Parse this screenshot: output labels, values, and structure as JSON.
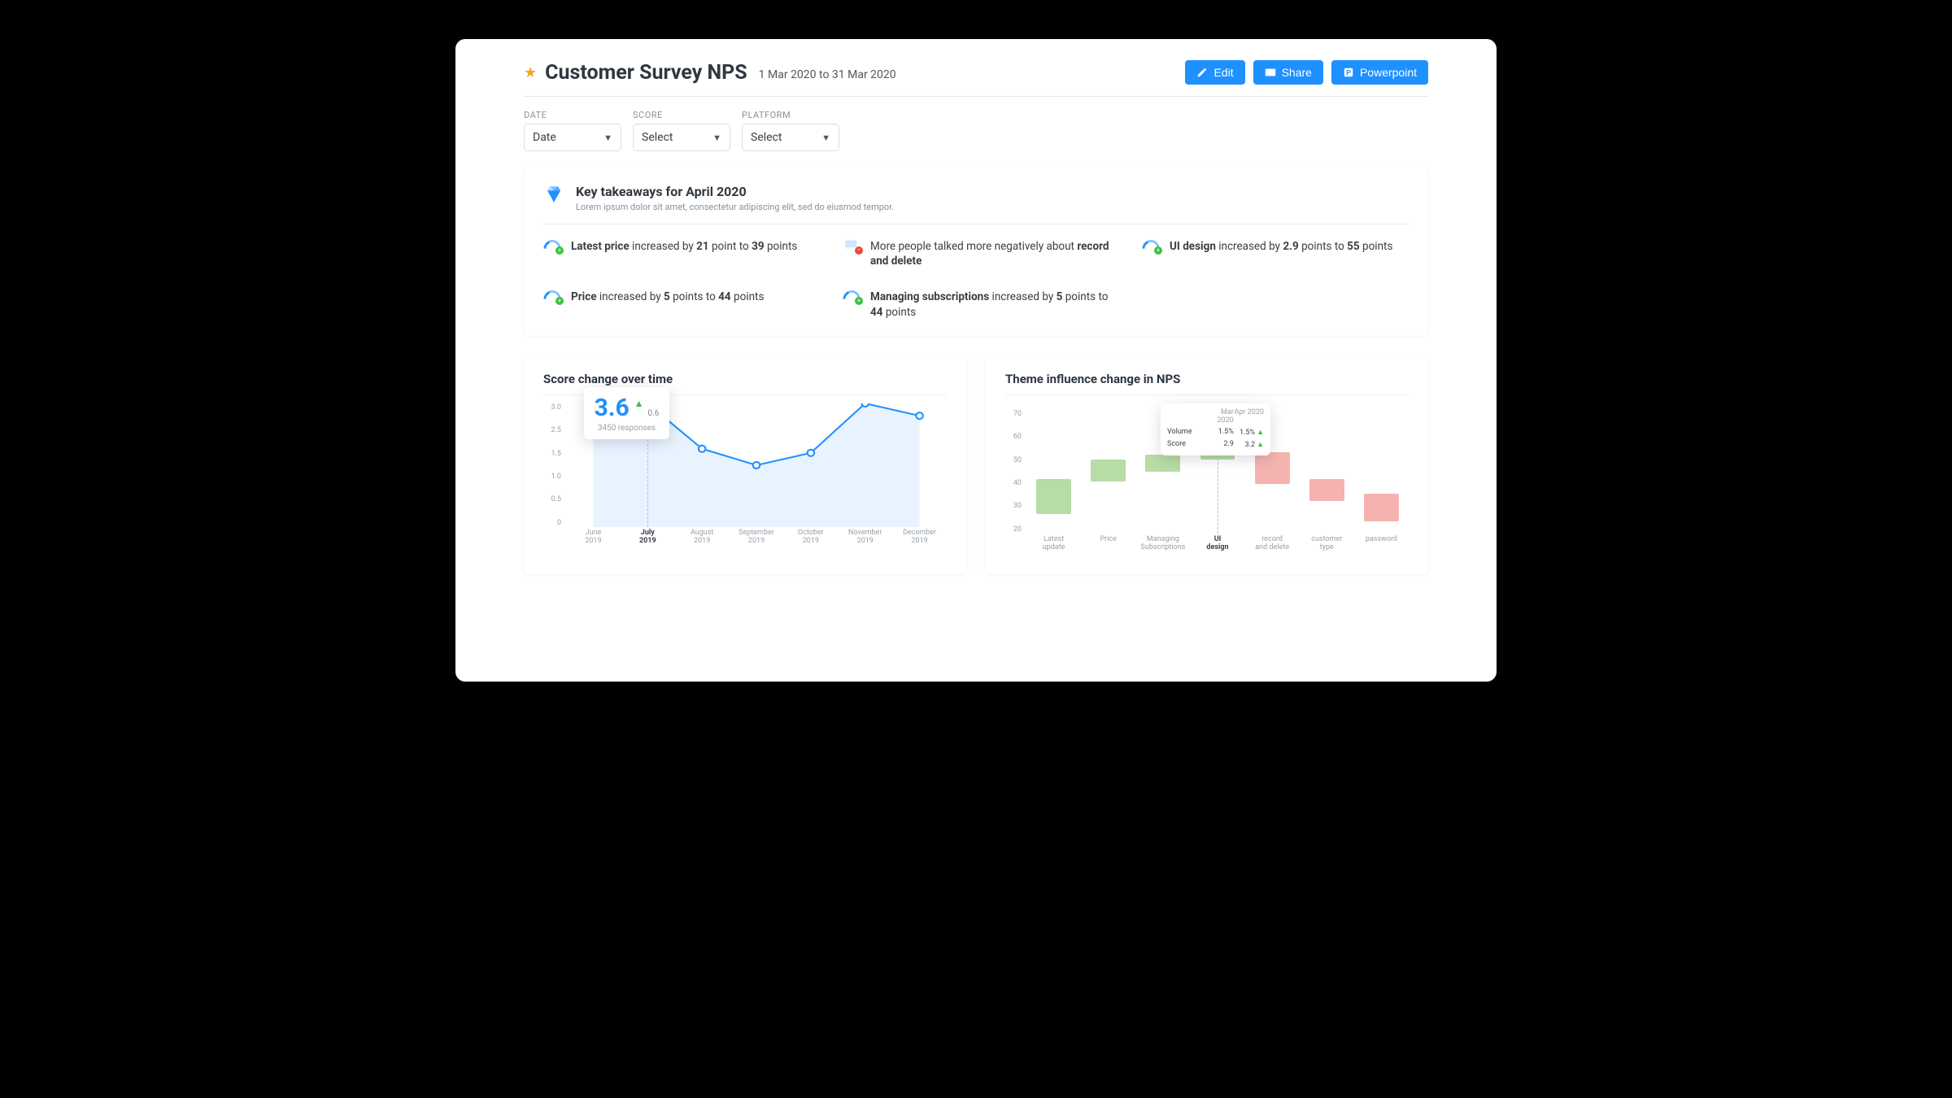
{
  "header": {
    "title": "Customer Survey NPS",
    "date_range": "1 Mar 2020 to 31 Mar 2020",
    "buttons": {
      "edit": "Edit",
      "share": "Share",
      "ppt": "Powerpoint"
    }
  },
  "filters": {
    "date": {
      "label": "DATE",
      "value": "Date"
    },
    "score": {
      "label": "SCORE",
      "value": "Select"
    },
    "platform": {
      "label": "PLATFORM",
      "value": "Select"
    }
  },
  "takeaways": {
    "title": "Key takeaways for April 2020",
    "subtitle": "Lorem ipsum dolor sit amet, consectetur adipiscing elit, sed do eiusmod tempor.",
    "items": [
      {
        "lead": "Latest price",
        "mid": " increased by ",
        "v1": "21",
        "mid2": " point to ",
        "v2": "39",
        "tail": " points",
        "dir": "pos"
      },
      {
        "plain_a": "More people talked more negatively about ",
        "bold": "record and delete",
        "dir": "neg",
        "icon": "chat"
      },
      {
        "lead": "UI design",
        "mid": " increased by ",
        "v1": "2.9",
        "mid2": " points to ",
        "v2": "55",
        "tail": " points",
        "dir": "pos"
      },
      {
        "lead": "Price",
        "mid": " increased by ",
        "v1": "5",
        "mid2": " points to ",
        "v2": "44",
        "tail": " points",
        "dir": "pos"
      },
      {
        "lead": "Managing subscriptions",
        "mid": " increased by ",
        "v1": "5",
        "mid2": " points to ",
        "v2": "44",
        "tail": " points",
        "dir": "pos"
      },
      {
        "blank": true
      }
    ]
  },
  "chart_data": [
    {
      "type": "line",
      "title": "Score change over time",
      "ylim": [
        0,
        3.0
      ],
      "yticks": [
        "3.0",
        "2.5",
        "1.5",
        "1.0",
        "0.5",
        "0"
      ],
      "categories": [
        "June 2019",
        "July 2019",
        "August 2019",
        "September 2019",
        "October 2019",
        "November 2019",
        "December 2019"
      ],
      "values": [
        2.7,
        3.0,
        1.9,
        1.5,
        1.8,
        3.0,
        2.7
      ],
      "highlight_index": 1,
      "tooltip": {
        "value": "3.6",
        "delta": "0.6",
        "responses": "3450 responses"
      }
    },
    {
      "type": "bar",
      "title": "Theme influence change in NPS",
      "ylim": [
        20,
        70
      ],
      "yticks": [
        "70",
        "60",
        "50",
        "40",
        "30",
        "20"
      ],
      "categories": [
        "Latest update",
        "Price",
        "Managing Subscriptions",
        "UI design",
        "record and delete",
        "customer type",
        "password"
      ],
      "series": [
        {
          "low": 28,
          "high": 42,
          "sign": "pos"
        },
        {
          "low": 41,
          "high": 50,
          "sign": "pos"
        },
        {
          "low": 45,
          "high": 52,
          "sign": "pos"
        },
        {
          "low": 50,
          "high": 57,
          "sign": "pos"
        },
        {
          "low": 40,
          "high": 53,
          "sign": "neg"
        },
        {
          "low": 33,
          "high": 42,
          "sign": "neg"
        },
        {
          "low": 25,
          "high": 36,
          "sign": "neg"
        }
      ],
      "highlight_index": 3,
      "tooltip": {
        "cols": [
          "Mar 2020",
          "Apr 2020"
        ],
        "rows": [
          {
            "label": "Volume",
            "a": "1.5%",
            "b": "1.5%",
            "up": true
          },
          {
            "label": "Score",
            "a": "2.9",
            "b": "3.2",
            "up": true
          }
        ]
      }
    }
  ]
}
